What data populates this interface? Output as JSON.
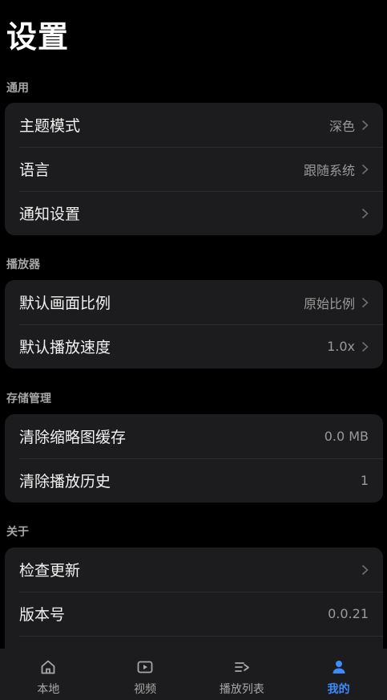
{
  "page": {
    "title": "设置"
  },
  "sections": {
    "general": {
      "label": "通用",
      "items": [
        {
          "label": "主题模式",
          "value": "深色"
        },
        {
          "label": "语言",
          "value": "跟随系统"
        },
        {
          "label": "通知设置",
          "value": ""
        }
      ]
    },
    "player": {
      "label": "播放器",
      "items": [
        {
          "label": "默认画面比例",
          "value": "原始比例"
        },
        {
          "label": "默认播放速度",
          "value": "1.0x"
        }
      ]
    },
    "storage": {
      "label": "存储管理",
      "items": [
        {
          "label": "清除缩略图缓存",
          "value": "0.0 MB"
        },
        {
          "label": "清除播放历史",
          "value": "1"
        }
      ]
    },
    "about": {
      "label": "关于",
      "items": [
        {
          "label": "检查更新",
          "value": ""
        },
        {
          "label": "版本号",
          "value": "0.0.21"
        }
      ]
    }
  },
  "tabbar": {
    "items": [
      {
        "label": "本地",
        "icon": "home-icon"
      },
      {
        "label": "视频",
        "icon": "video-play-icon"
      },
      {
        "label": "播放列表",
        "icon": "playlist-icon"
      },
      {
        "label": "我的",
        "icon": "person-icon"
      }
    ],
    "active_color": "#3d8bfd"
  }
}
